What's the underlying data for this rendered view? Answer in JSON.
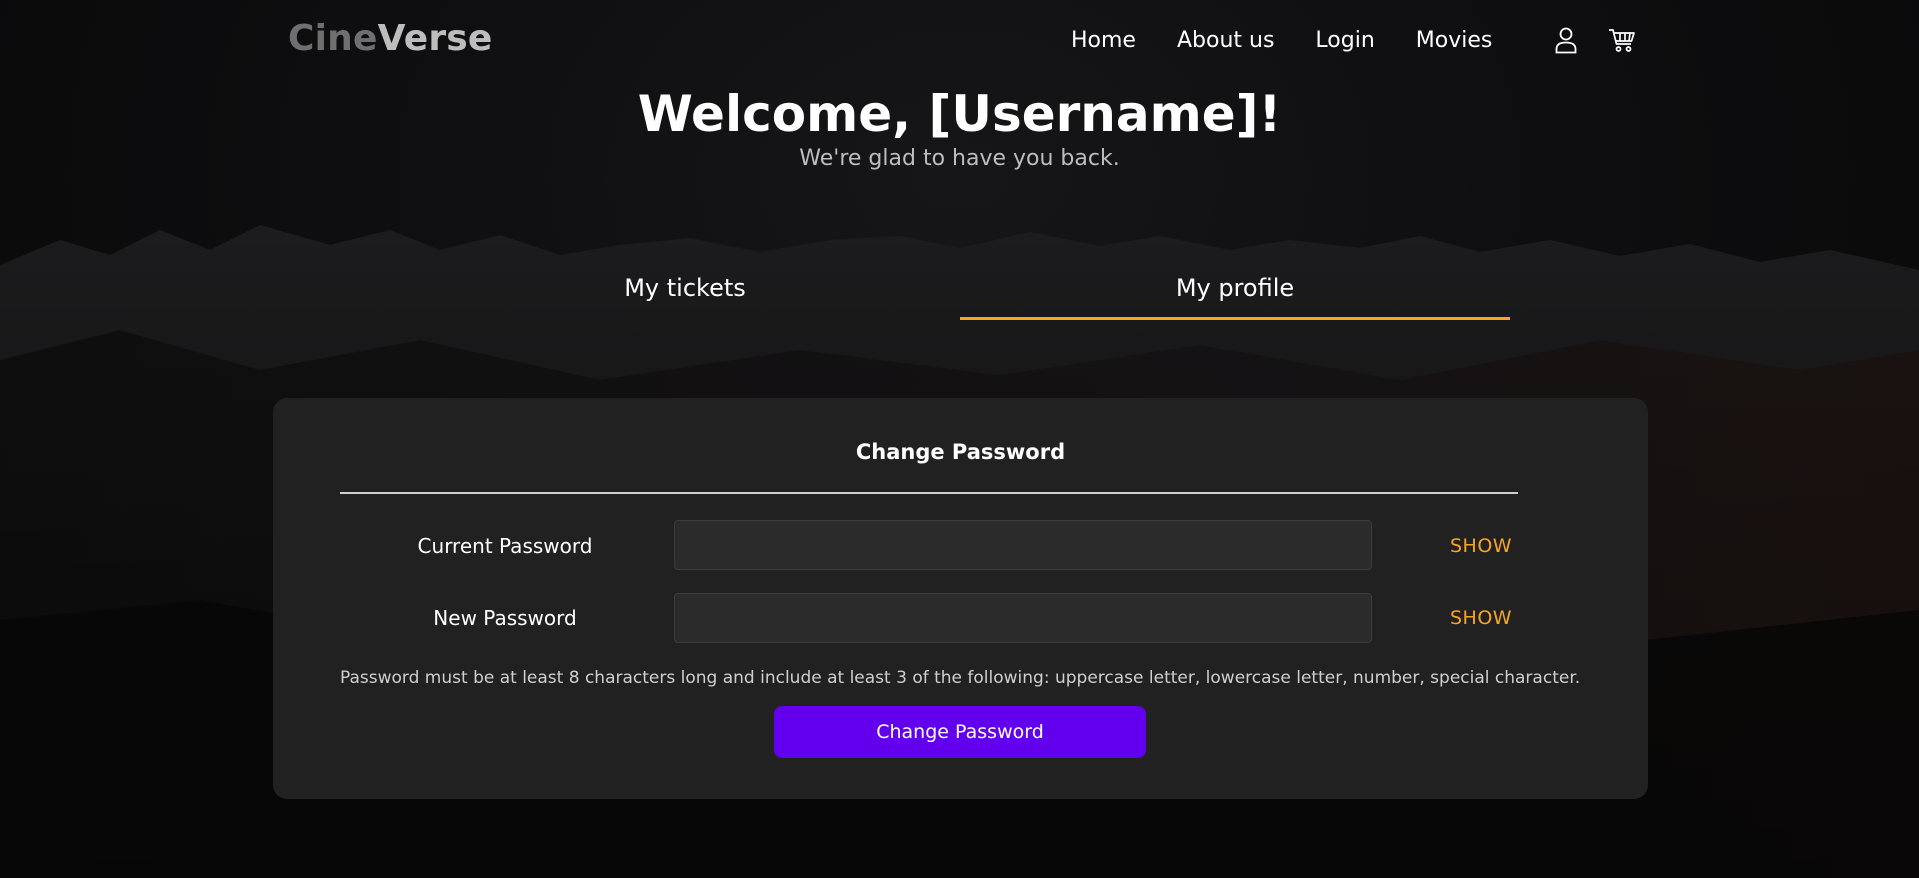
{
  "header": {
    "logo_part1": "Cine",
    "logo_part2": "Verse",
    "nav": [
      "Home",
      "About us",
      "Login",
      "Movies"
    ],
    "icons": [
      "user-icon",
      "cart-icon"
    ]
  },
  "welcome": {
    "title": "Welcome, [Username]!",
    "subtitle": "We're glad to have you back."
  },
  "tabs": [
    {
      "label": "My tickets",
      "active": false
    },
    {
      "label": "My profile",
      "active": true
    }
  ],
  "change_password": {
    "title": "Change Password",
    "current_label": "Current Password",
    "current_value": "",
    "new_label": "New Password",
    "new_value": "",
    "show_label": "SHOW",
    "hint": "Password must be at least 8 characters long and include at least 3 of the following: uppercase letter, lowercase letter, number, special character.",
    "submit_label": "Change Password"
  },
  "colors": {
    "accent": "#f5a623",
    "primary_button": "#6200ee",
    "card_background": "#212121"
  }
}
